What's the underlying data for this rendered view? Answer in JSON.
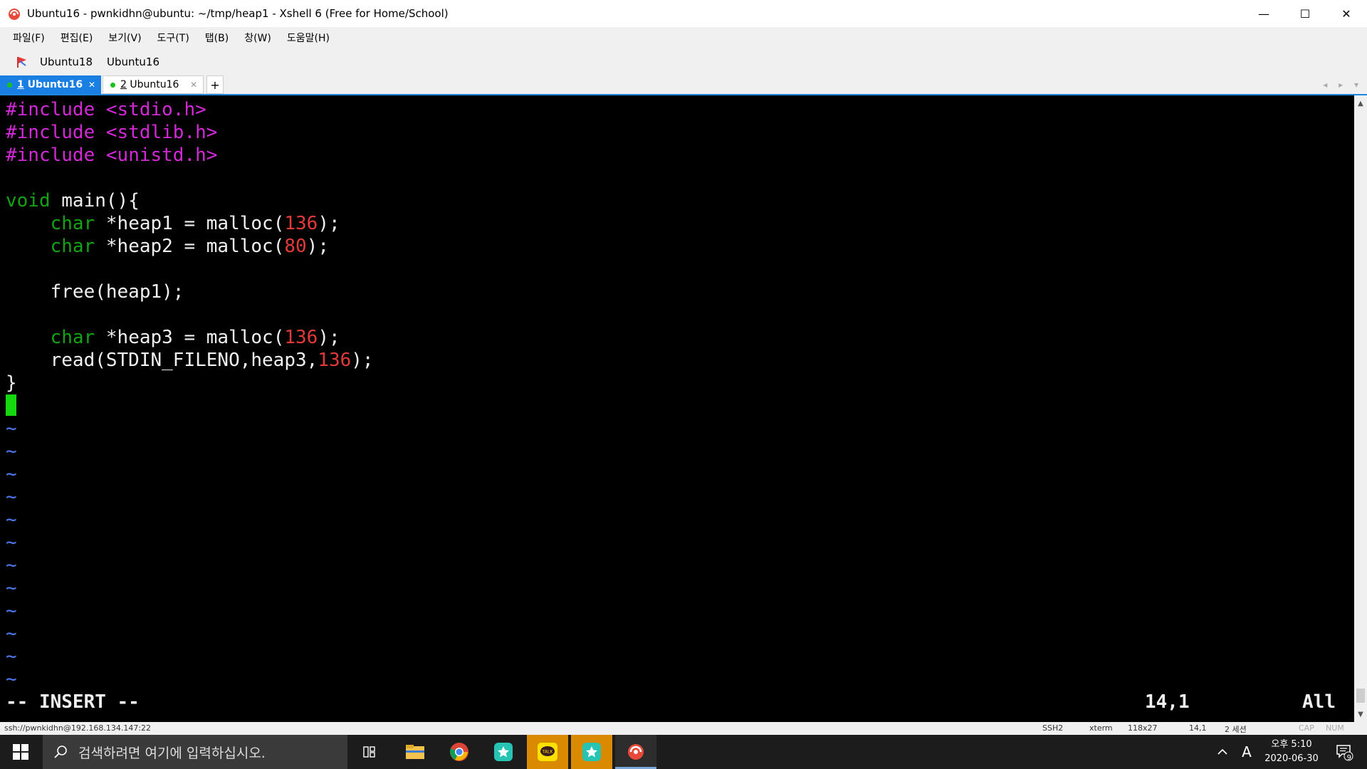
{
  "window": {
    "title": "Ubuntu16 - pwnkidhn@ubuntu: ~/tmp/heap1 - Xshell 6 (Free for Home/School)",
    "minimize": "—",
    "maximize": "☐",
    "close": "✕"
  },
  "menu": [
    "파일(F)",
    "편집(E)",
    "보기(V)",
    "도구(T)",
    "탭(B)",
    "창(W)",
    "도움말(H)"
  ],
  "links": [
    "Ubuntu18",
    "Ubuntu16"
  ],
  "tabs": [
    {
      "number": "1",
      "label": "Ubuntu16",
      "active": true
    },
    {
      "number": "2",
      "label": "Ubuntu16",
      "active": false
    }
  ],
  "tab_add": "+",
  "tab_nav": "◂ ▸ ▾",
  "editor": {
    "lines": [
      [
        {
          "t": "#include ",
          "c": "pre"
        },
        {
          "t": "<stdio.h>",
          "c": "pre"
        }
      ],
      [
        {
          "t": "#include ",
          "c": "pre"
        },
        {
          "t": "<stdlib.h>",
          "c": "pre"
        }
      ],
      [
        {
          "t": "#include ",
          "c": "pre"
        },
        {
          "t": "<unistd.h>",
          "c": "pre"
        }
      ],
      [],
      [
        {
          "t": "void",
          "c": "kw"
        },
        {
          "t": " main(){",
          "c": ""
        }
      ],
      [
        {
          "t": "    ",
          "c": ""
        },
        {
          "t": "char",
          "c": "kw"
        },
        {
          "t": " *heap1 = malloc(",
          "c": ""
        },
        {
          "t": "136",
          "c": "num"
        },
        {
          "t": ");",
          "c": ""
        }
      ],
      [
        {
          "t": "    ",
          "c": ""
        },
        {
          "t": "char",
          "c": "kw"
        },
        {
          "t": " *heap2 = malloc(",
          "c": ""
        },
        {
          "t": "80",
          "c": "num"
        },
        {
          "t": ");",
          "c": ""
        }
      ],
      [],
      [
        {
          "t": "    free(heap1);",
          "c": ""
        }
      ],
      [],
      [
        {
          "t": "    ",
          "c": ""
        },
        {
          "t": "char",
          "c": "kw"
        },
        {
          "t": " *heap3 = malloc(",
          "c": ""
        },
        {
          "t": "136",
          "c": "num"
        },
        {
          "t": ");",
          "c": ""
        }
      ],
      [
        {
          "t": "    read(STDIN_FILENO,heap3,",
          "c": ""
        },
        {
          "t": "136",
          "c": "num"
        },
        {
          "t": ");",
          "c": ""
        }
      ],
      [
        {
          "t": "}",
          "c": ""
        }
      ]
    ],
    "tilde_count": 12,
    "tilde": "~",
    "mode": "-- INSERT --",
    "position": "14,1",
    "scroll": "All"
  },
  "statusbar": {
    "connection": "ssh://pwnkidhn@192.168.134.147:22",
    "protocol": "SSH2",
    "term": "xterm",
    "size": "118x27",
    "cursor": "14,1",
    "sessions": "2 세션",
    "caps": "CAP",
    "num": "NUM"
  },
  "taskbar": {
    "search_placeholder": "검색하려면 여기에 입력하십시오.",
    "ime": "A",
    "time": "오후 5:10",
    "date": "2020-06-30",
    "notifications": "9"
  },
  "colors": {
    "tab_active": "#1a7fe3",
    "terminal_bg": "#000000",
    "preprocessor": "#d228d6",
    "keyword": "#12a312",
    "number": "#e23a3a",
    "tilde": "#4d7bf0",
    "cursor": "#16d80e"
  }
}
